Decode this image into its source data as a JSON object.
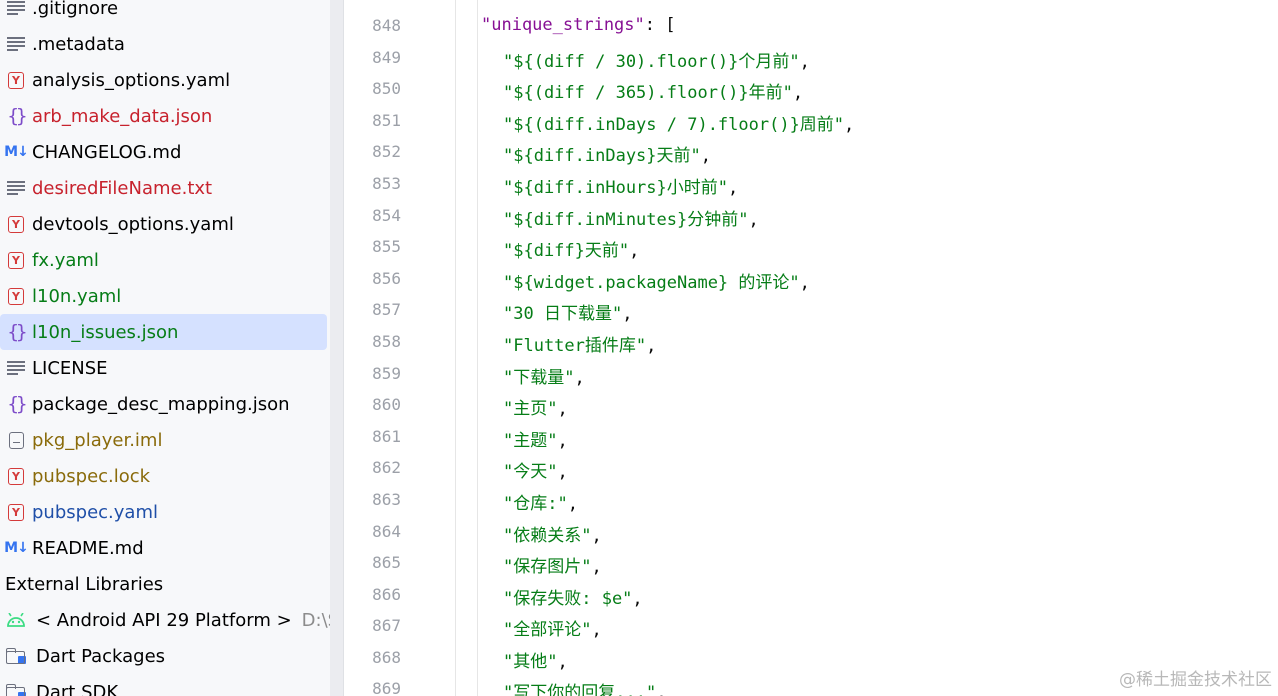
{
  "project_tree": {
    "rows": [
      {
        "label": ".gitignore",
        "icon": "gitignore-icon",
        "color": "#000000"
      },
      {
        "label": ".metadata",
        "icon": "text-file-icon",
        "color": "#000000"
      },
      {
        "label": "analysis_options.yaml",
        "icon": "yaml-file-icon",
        "color": "#000000"
      },
      {
        "label": "arb_make_data.json",
        "icon": "json-file-icon",
        "color": "#c7222d"
      },
      {
        "label": "CHANGELOG.md",
        "icon": "markdown-file-icon",
        "color": "#000000"
      },
      {
        "label": "desiredFileName.txt",
        "icon": "text-file-icon",
        "color": "#c7222d"
      },
      {
        "label": "devtools_options.yaml",
        "icon": "yaml-file-icon",
        "color": "#000000"
      },
      {
        "label": "fx.yaml",
        "icon": "yaml-file-icon",
        "color": "#067d17"
      },
      {
        "label": "l10n.yaml",
        "icon": "yaml-file-icon",
        "color": "#067d17"
      },
      {
        "label": "l10n_issues.json",
        "icon": "json-file-icon",
        "color": "#067d17",
        "selected": true
      },
      {
        "label": "LICENSE",
        "icon": "text-file-icon",
        "color": "#000000"
      },
      {
        "label": "package_desc_mapping.json",
        "icon": "json-file-icon",
        "color": "#000000"
      },
      {
        "label": "pkg_player.iml",
        "icon": "iml-file-icon",
        "color": "#8a6b0b"
      },
      {
        "label": "pubspec.lock",
        "icon": "yaml-file-icon",
        "color": "#8a6b0b"
      },
      {
        "label": "pubspec.yaml",
        "icon": "yaml-file-icon",
        "color": "#1f4fa8"
      },
      {
        "label": "README.md",
        "icon": "markdown-file-icon",
        "color": "#000000"
      }
    ],
    "external_libraries_label": "External Libraries",
    "libraries": [
      {
        "label": "< Android API 29 Platform >",
        "hint": "D:\\SDK",
        "icon": "android-icon"
      },
      {
        "label": "Dart Packages",
        "icon": "library-folder-icon"
      },
      {
        "label": "Dart SDK",
        "icon": "library-folder-icon"
      }
    ]
  },
  "editor": {
    "lines": [
      {
        "n": "848",
        "kind": "key",
        "text": "\"unique_strings\": ["
      },
      {
        "n": "849",
        "kind": "str",
        "text": "\"${(diff / 30).floor()}个月前\","
      },
      {
        "n": "850",
        "kind": "str",
        "text": "\"${(diff / 365).floor()}年前\","
      },
      {
        "n": "851",
        "kind": "str",
        "text": "\"${(diff.inDays / 7).floor()}周前\","
      },
      {
        "n": "852",
        "kind": "str",
        "text": "\"${diff.inDays}天前\","
      },
      {
        "n": "853",
        "kind": "str",
        "text": "\"${diff.inHours}小时前\","
      },
      {
        "n": "854",
        "kind": "str",
        "text": "\"${diff.inMinutes}分钟前\","
      },
      {
        "n": "855",
        "kind": "str",
        "text": "\"${diff}天前\","
      },
      {
        "n": "856",
        "kind": "str",
        "text": "\"${widget.packageName} 的评论\","
      },
      {
        "n": "857",
        "kind": "str",
        "text": "\"30 日下载量\","
      },
      {
        "n": "858",
        "kind": "str",
        "text": "\"Flutter插件库\","
      },
      {
        "n": "859",
        "kind": "str",
        "text": "\"下载量\","
      },
      {
        "n": "860",
        "kind": "str",
        "text": "\"主页\","
      },
      {
        "n": "861",
        "kind": "str",
        "text": "\"主题\","
      },
      {
        "n": "862",
        "kind": "str",
        "text": "\"今天\","
      },
      {
        "n": "863",
        "kind": "str",
        "text": "\"仓库:\","
      },
      {
        "n": "864",
        "kind": "str",
        "text": "\"依赖关系\","
      },
      {
        "n": "865",
        "kind": "str",
        "text": "\"保存图片\","
      },
      {
        "n": "866",
        "kind": "str",
        "text": "\"保存失败: $e\","
      },
      {
        "n": "867",
        "kind": "str",
        "text": "\"全部评论\","
      },
      {
        "n": "868",
        "kind": "str",
        "text": "\"其他\","
      },
      {
        "n": "869",
        "kind": "str",
        "text": "\"写下你的回复...\","
      }
    ],
    "string_color": "#067d17",
    "key_color": "#871094"
  },
  "watermark": "@稀土掘金技术社区"
}
